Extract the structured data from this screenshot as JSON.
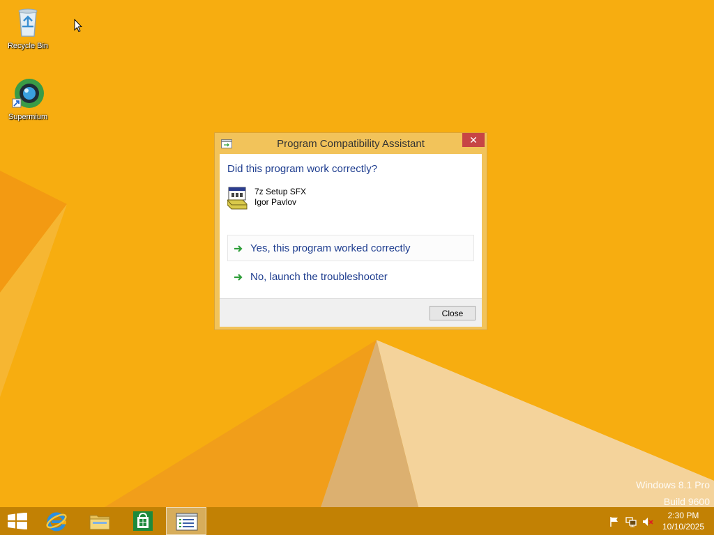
{
  "desktop": {
    "icons": [
      {
        "label": "Recycle Bin",
        "icon": "recycle-bin-icon"
      },
      {
        "label": "Supermium",
        "icon": "supermium-browser-icon"
      }
    ],
    "watermark": {
      "line1": "Windows 8.1 Pro",
      "line2": "Build 9600"
    }
  },
  "dialog": {
    "title": "Program Compatibility Assistant",
    "close_glyph": "✕",
    "question": "Did this program work correctly?",
    "program": {
      "name": "7z Setup SFX",
      "publisher": "Igor Pavlov"
    },
    "options": [
      {
        "label": "Yes, this program worked correctly"
      },
      {
        "label": "No, launch the troubleshooter"
      }
    ],
    "close_button": "Close"
  },
  "taskbar": {
    "items": [
      {
        "name": "start",
        "icon": "windows-logo-icon"
      },
      {
        "name": "internet-explorer",
        "icon": "internet-explorer-icon"
      },
      {
        "name": "file-explorer",
        "icon": "folder-icon"
      },
      {
        "name": "store",
        "icon": "store-icon"
      },
      {
        "name": "program-compatibility-assistant",
        "icon": "window-list-icon"
      }
    ],
    "tray": {
      "time": "2:30 PM",
      "date": "10/10/2025"
    }
  },
  "colors": {
    "wallpaper": "#f7ad10",
    "dialog_frame": "#f2c35a",
    "close_red": "#c74545",
    "link_blue": "#1e3d8f",
    "arrow_green": "#2f9e3a"
  }
}
